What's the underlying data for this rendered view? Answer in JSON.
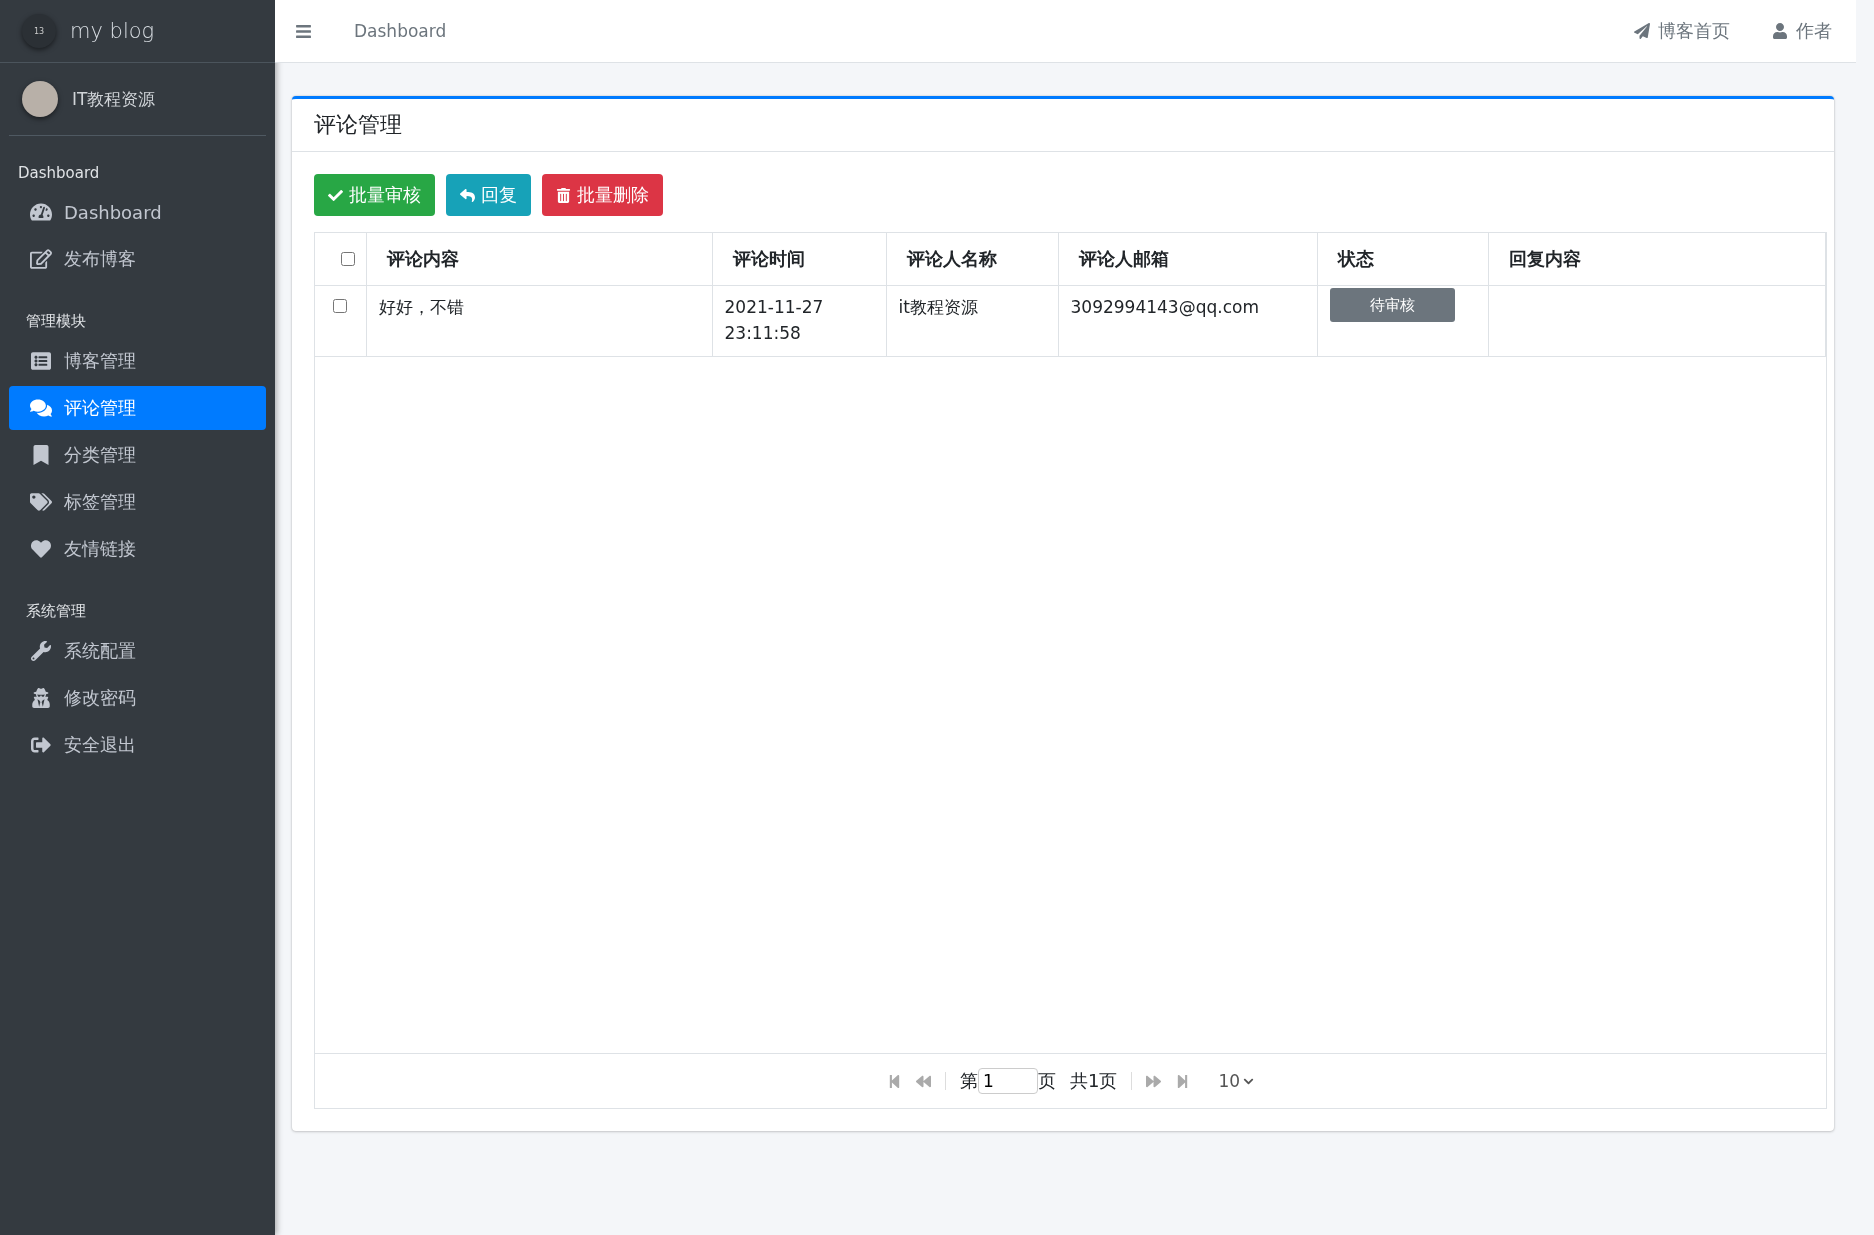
{
  "sidebar": {
    "brand": {
      "logo_text": "13",
      "title": "my blog"
    },
    "user": {
      "name": "IT教程资源"
    },
    "sections": [
      {
        "heading": "Dashboard",
        "items": [
          {
            "label": "Dashboard",
            "selected": false
          },
          {
            "label": "发布博客",
            "selected": false
          }
        ]
      },
      {
        "heading": "管理模块",
        "items": [
          {
            "label": "博客管理",
            "selected": false
          },
          {
            "label": "评论管理",
            "selected": true
          },
          {
            "label": "分类管理",
            "selected": false
          },
          {
            "label": "标签管理",
            "selected": false
          },
          {
            "label": "友情链接",
            "selected": false
          }
        ]
      },
      {
        "heading": "系统管理",
        "items": [
          {
            "label": "系统配置",
            "selected": false
          },
          {
            "label": "修改密码",
            "selected": false
          },
          {
            "label": "安全退出",
            "selected": false
          }
        ]
      }
    ]
  },
  "topbar": {
    "breadcrumb": "Dashboard",
    "links": [
      "博客首页",
      "作者"
    ]
  },
  "card": {
    "title": "评论管理",
    "buttons": [
      {
        "label": "批量审核",
        "kind": "success"
      },
      {
        "label": "回复",
        "kind": "info"
      },
      {
        "label": "批量删除",
        "kind": "danger"
      }
    ],
    "table": {
      "select_all_checked": false,
      "columns": [
        "评论内容",
        "评论时间",
        "评论人名称",
        "评论人邮箱",
        "状态",
        "回复内容"
      ],
      "rows": [
        {
          "checked": false,
          "content": "好好，不错",
          "time": [
            "2021-11-27",
            "23:11:58"
          ],
          "author": "it教程资源",
          "email": "3092994143@qq.com",
          "status": "待审核",
          "reply": ""
        }
      ]
    },
    "pager": {
      "before": "第",
      "page": "1",
      "after": "页",
      "total": "共1页",
      "page_size": "10"
    }
  }
}
